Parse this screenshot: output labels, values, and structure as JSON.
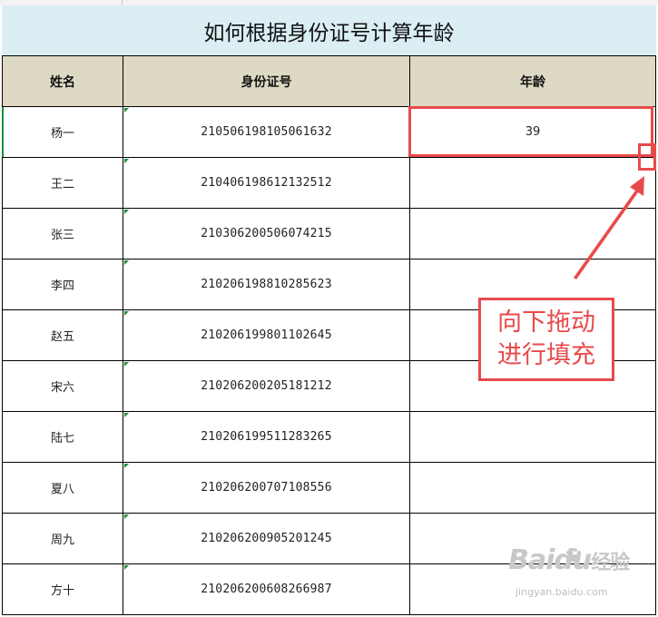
{
  "title": "如何根据身份证号计算年龄",
  "headers": {
    "name": "姓名",
    "id": "身份证号",
    "age": "年龄"
  },
  "rows": [
    {
      "name": "杨一",
      "id": "210506198105061632",
      "age": "39"
    },
    {
      "name": "王二",
      "id": "210406198612132512",
      "age": ""
    },
    {
      "name": "张三",
      "id": "210306200506074215",
      "age": ""
    },
    {
      "name": "李四",
      "id": "210206198810285623",
      "age": ""
    },
    {
      "name": "赵五",
      "id": "210206199801102645",
      "age": ""
    },
    {
      "name": "宋六",
      "id": "210206200205181212",
      "age": ""
    },
    {
      "name": "陆七",
      "id": "210206199511283265",
      "age": ""
    },
    {
      "name": "夏八",
      "id": "210206200707108556",
      "age": ""
    },
    {
      "name": "周九",
      "id": "210206200905201245",
      "age": ""
    },
    {
      "name": "方十",
      "id": "210206200608266987",
      "age": ""
    }
  ],
  "callout": {
    "line1": "向下拖动",
    "line2": "进行填充"
  },
  "watermark": {
    "brand": "Baidu",
    "brand_suffix": "经验",
    "url": "jingyan.baidu.com"
  },
  "colors": {
    "title_bg": "#daeef3",
    "header_bg": "#ddd9c4",
    "annotation": "#e84a4a",
    "indicator": "#1e8c3a"
  }
}
